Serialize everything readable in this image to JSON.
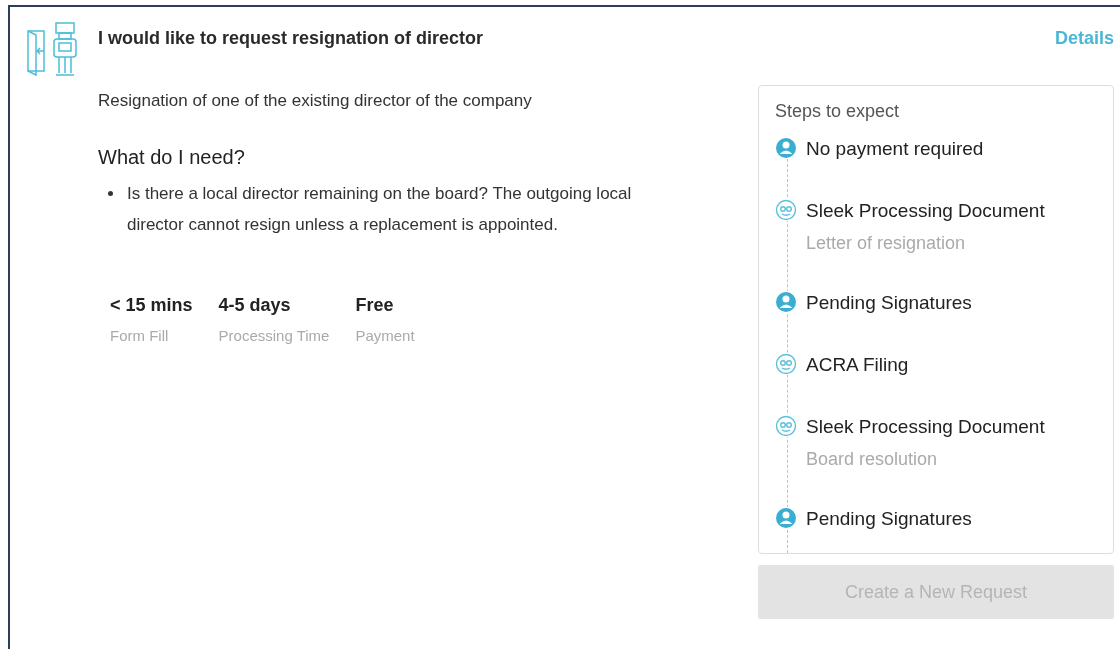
{
  "request": {
    "title": "I would like to request resignation of director",
    "details_link": "Details",
    "description": "Resignation of one of the existing director of the company",
    "needs_heading": "What do I need?",
    "needs": [
      "Is there a local director remaining on the board? The outgoing local director cannot resign unless a replacement is appointed."
    ],
    "stats": [
      {
        "value": "< 15 mins",
        "label": "Form Fill"
      },
      {
        "value": "4-5 days",
        "label": "Processing Time"
      },
      {
        "value": "Free",
        "label": "Payment"
      }
    ]
  },
  "steps": {
    "heading": "Steps to expect",
    "items": [
      {
        "kind": "person",
        "title": "No payment required"
      },
      {
        "kind": "robot",
        "title": "Sleek Processing Document",
        "subtitle": "Letter of resignation"
      },
      {
        "kind": "person",
        "title": "Pending Signatures"
      },
      {
        "kind": "robot",
        "title": "ACRA Filing"
      },
      {
        "kind": "robot",
        "title": "Sleek Processing Document",
        "subtitle": "Board resolution"
      },
      {
        "kind": "person",
        "title": "Pending Signatures"
      }
    ]
  },
  "create_button": {
    "label": "Create a New Request",
    "disabled": true
  }
}
